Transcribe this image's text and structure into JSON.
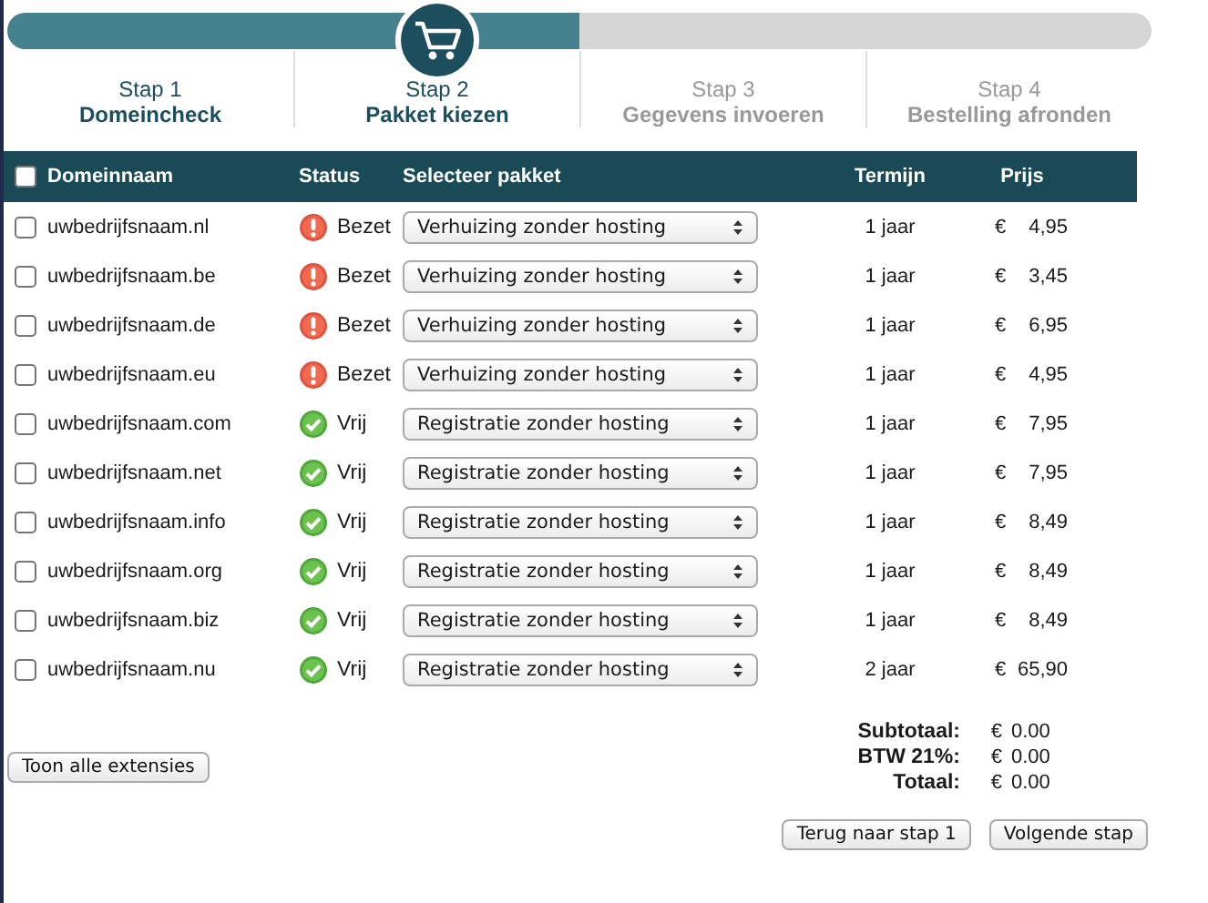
{
  "progress": {
    "level": 0.5
  },
  "steps": [
    {
      "number": "Stap 1",
      "label": "Domeincheck",
      "active": true,
      "selected": false
    },
    {
      "number": "Stap 2",
      "label": "Pakket kiezen",
      "active": true,
      "selected": true
    },
    {
      "number": "Stap 3",
      "label": "Gegevens invoeren",
      "active": false,
      "selected": false
    },
    {
      "number": "Stap 4",
      "label": "Bestelling afronden",
      "active": false,
      "selected": false
    }
  ],
  "table": {
    "select_all_checked": false,
    "columns": [
      "Domeinnaam",
      "Status",
      "Selecteer pakket",
      "Termijn",
      "Prijs"
    ],
    "rows": [
      {
        "checked": false,
        "domain": "uwbedrijfsnaam.nl",
        "kind": "taken",
        "status": "Bezet",
        "package": "Verhuizing zonder hosting",
        "term": "1 jaar",
        "currency": "€",
        "price": "4,95"
      },
      {
        "checked": false,
        "domain": "uwbedrijfsnaam.be",
        "kind": "taken",
        "status": "Bezet",
        "package": "Verhuizing zonder hosting",
        "term": "1 jaar",
        "currency": "€",
        "price": "3,45"
      },
      {
        "checked": false,
        "domain": "uwbedrijfsnaam.de",
        "kind": "taken",
        "status": "Bezet",
        "package": "Verhuizing zonder hosting",
        "term": "1 jaar",
        "currency": "€",
        "price": "6,95"
      },
      {
        "checked": false,
        "domain": "uwbedrijfsnaam.eu",
        "kind": "taken",
        "status": "Bezet",
        "package": "Verhuizing zonder hosting",
        "term": "1 jaar",
        "currency": "€",
        "price": "4,95"
      },
      {
        "checked": false,
        "domain": "uwbedrijfsnaam.com",
        "kind": "free",
        "status": "Vrij",
        "package": "Registratie zonder hosting",
        "term": "1 jaar",
        "currency": "€",
        "price": "7,95"
      },
      {
        "checked": false,
        "domain": "uwbedrijfsnaam.net",
        "kind": "free",
        "status": "Vrij",
        "package": "Registratie zonder hosting",
        "term": "1 jaar",
        "currency": "€",
        "price": "7,95"
      },
      {
        "checked": false,
        "domain": "uwbedrijfsnaam.info",
        "kind": "free",
        "status": "Vrij",
        "package": "Registratie zonder hosting",
        "term": "1 jaar",
        "currency": "€",
        "price": "8,49"
      },
      {
        "checked": false,
        "domain": "uwbedrijfsnaam.org",
        "kind": "free",
        "status": "Vrij",
        "package": "Registratie zonder hosting",
        "term": "1 jaar",
        "currency": "€",
        "price": "8,49"
      },
      {
        "checked": false,
        "domain": "uwbedrijfsnaam.biz",
        "kind": "free",
        "status": "Vrij",
        "package": "Registratie zonder hosting",
        "term": "1 jaar",
        "currency": "€",
        "price": "8,49"
      },
      {
        "checked": false,
        "domain": "uwbedrijfsnaam.nu",
        "kind": "free",
        "status": "Vrij",
        "package": "Registratie zonder hosting",
        "term": "2 jaar",
        "currency": "€",
        "price": "65,90"
      }
    ]
  },
  "show_all_button": "Toon alle extensies",
  "totals": [
    {
      "label": "Subtotaal:",
      "currency": "€",
      "value": "0.00"
    },
    {
      "label": "BTW 21%:",
      "currency": "€",
      "value": "0.00"
    },
    {
      "label": "Totaal:",
      "currency": "€",
      "value": "0.00"
    }
  ],
  "buttons": [
    "Terug naar stap 1",
    "Volgende stap"
  ]
}
